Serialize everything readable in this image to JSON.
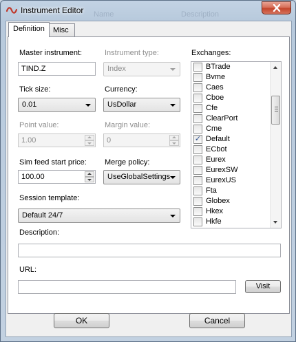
{
  "window": {
    "title": "Instrument Editor",
    "background_columns": [
      "Name",
      "Description"
    ]
  },
  "tabs": [
    {
      "label": "Definition",
      "active": true
    },
    {
      "label": "Misc",
      "active": false
    }
  ],
  "form": {
    "master_instrument": {
      "label": "Master instrument:",
      "value": "TIND.Z"
    },
    "instrument_type": {
      "label": "Instrument type:",
      "value": "Index",
      "enabled": false
    },
    "tick_size": {
      "label": "Tick size:",
      "value": "0.01"
    },
    "currency": {
      "label": "Currency:",
      "value": "UsDollar"
    },
    "point_value": {
      "label": "Point value:",
      "value": "1.00",
      "enabled": false
    },
    "margin_value": {
      "label": "Margin value:",
      "value": "0",
      "enabled": false
    },
    "sim_feed_start_price": {
      "label": "Sim feed start price:",
      "value": "100.00"
    },
    "merge_policy": {
      "label": "Merge policy:",
      "value": "UseGlobalSettings"
    },
    "session_template": {
      "label": "Session template:",
      "value": "Default 24/7"
    },
    "description": {
      "label": "Description:",
      "value": ""
    },
    "url": {
      "label": "URL:",
      "value": ""
    }
  },
  "exchanges": {
    "label": "Exchanges:",
    "items": [
      {
        "name": "BTrade",
        "checked": false
      },
      {
        "name": "Bvme",
        "checked": false
      },
      {
        "name": "Caes",
        "checked": false
      },
      {
        "name": "Cboe",
        "checked": false
      },
      {
        "name": "Cfe",
        "checked": false
      },
      {
        "name": "ClearPort",
        "checked": false
      },
      {
        "name": "Cme",
        "checked": false
      },
      {
        "name": "Default",
        "checked": true
      },
      {
        "name": "ECbot",
        "checked": false
      },
      {
        "name": "Eurex",
        "checked": false
      },
      {
        "name": "EurexSW",
        "checked": false
      },
      {
        "name": "EurexUS",
        "checked": false
      },
      {
        "name": "Fta",
        "checked": false
      },
      {
        "name": "Globex",
        "checked": false
      },
      {
        "name": "Hkex",
        "checked": false
      },
      {
        "name": "Hkfe",
        "checked": false
      }
    ]
  },
  "buttons": {
    "visit": "Visit",
    "ok": "OK",
    "cancel": "Cancel",
    "check_mark": "✓"
  },
  "colors": {
    "close_button": "#c4452c",
    "app_icon": "#c0392b",
    "check": "#2b4f8c"
  }
}
